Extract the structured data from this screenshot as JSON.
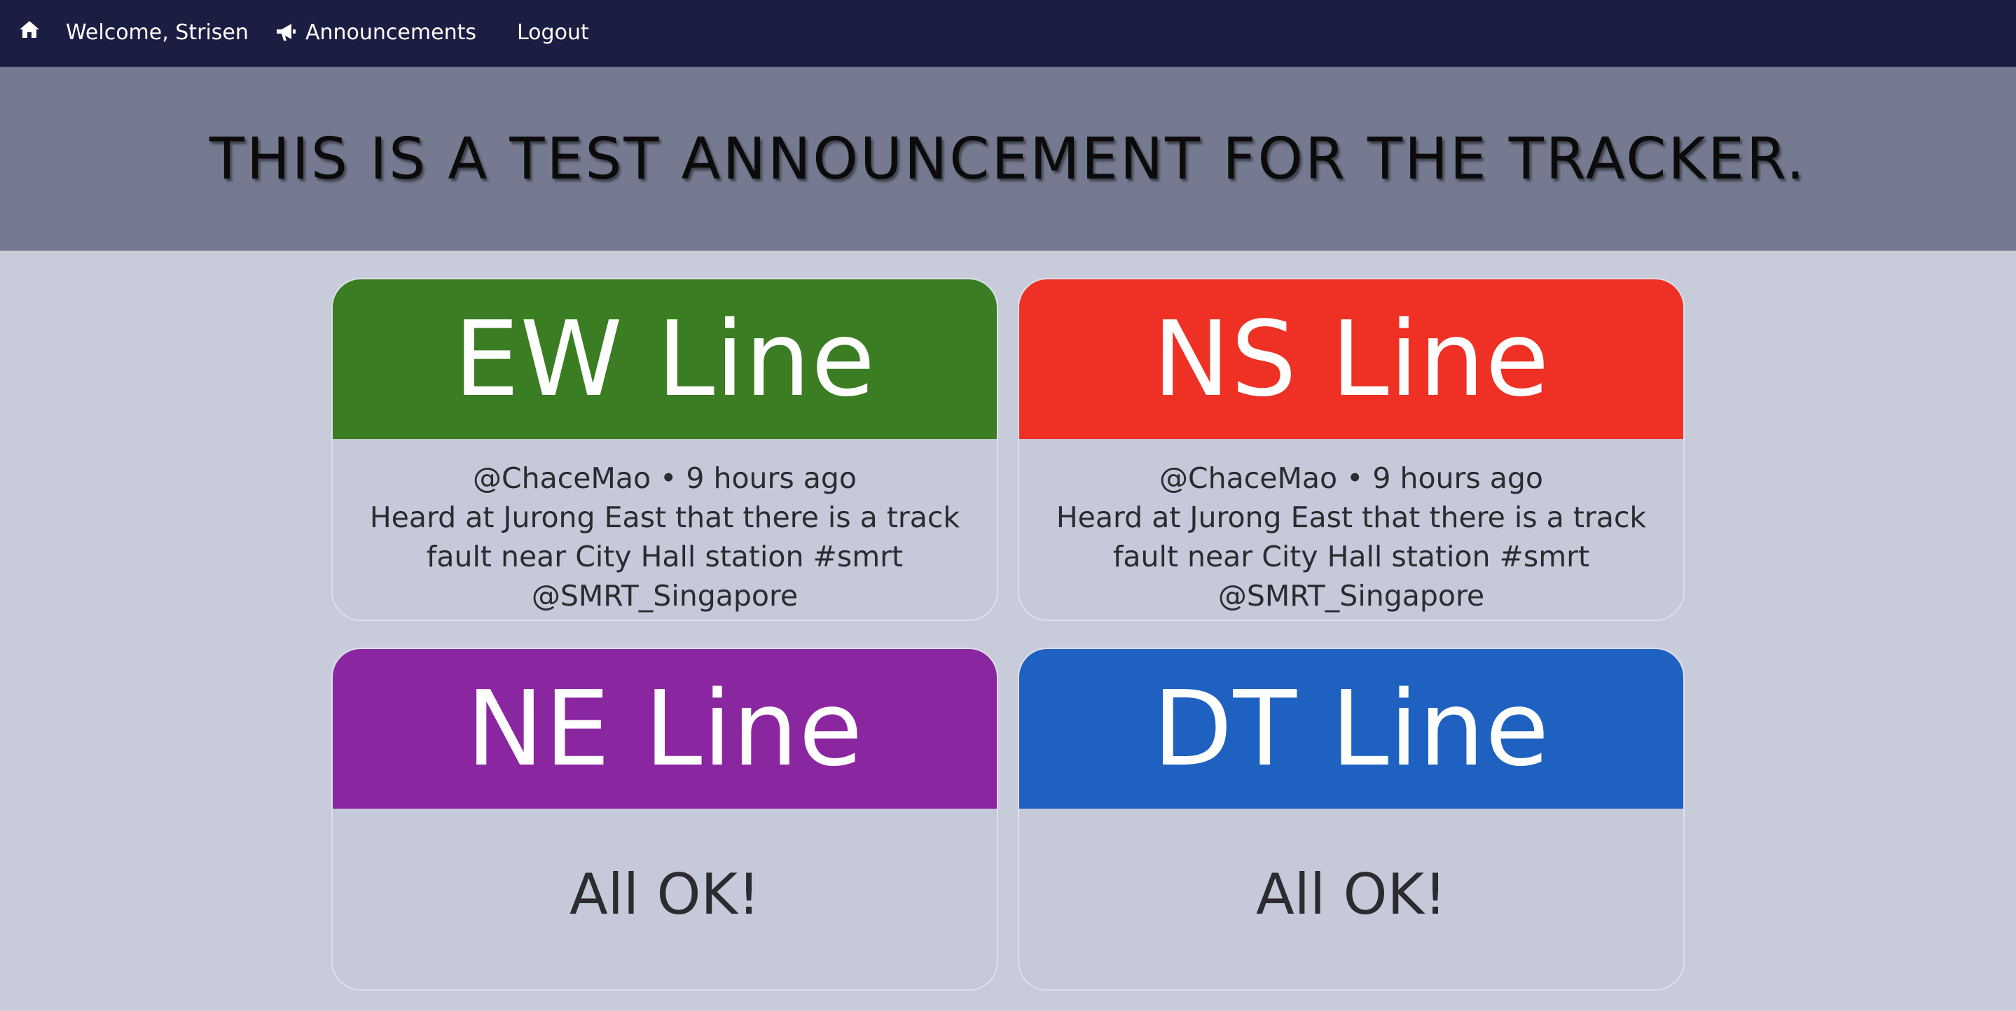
{
  "nav": {
    "welcome": "Welcome, Strisen",
    "announcements": "Announcements",
    "logout": "Logout",
    "home_icon": "home-icon",
    "announcement_icon": "megaphone-icon"
  },
  "banner": {
    "text": "THIS IS A TEST ANNOUNCEMENT FOR THE TRACKER."
  },
  "lines": [
    {
      "name": "EW Line",
      "color": "#3a7d23",
      "meta": "@ChaceMao • 9 hours ago",
      "message": "Heard at Jurong East that there is a track fault near City Hall station #smrt @SMRT_Singapore"
    },
    {
      "name": "NS Line",
      "color": "#ee3124",
      "meta": "@ChaceMao • 9 hours ago",
      "message": "Heard at Jurong East that there is a track fault near City Hall station #smrt @SMRT_Singapore"
    },
    {
      "name": "NE Line",
      "color": "#8b26a1",
      "status": "All OK!"
    },
    {
      "name": "DT Line",
      "color": "#1f61c1",
      "status": "All OK!"
    }
  ]
}
